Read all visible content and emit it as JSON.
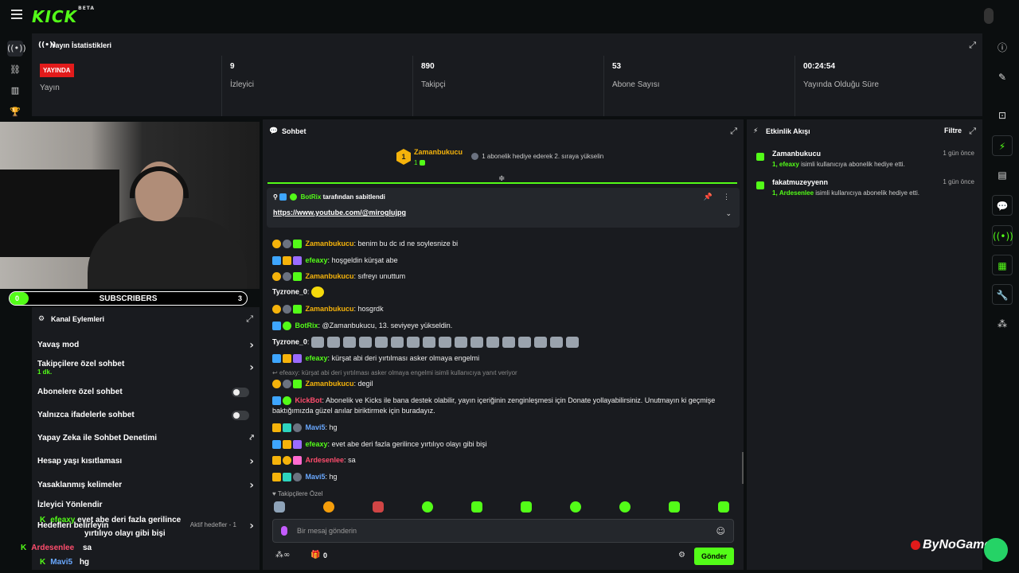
{
  "brand": {
    "logo": "KICK",
    "beta": "BETA"
  },
  "stats": {
    "title": "Yayın İstatistikleri",
    "live_badge": "YAYINDA",
    "items": [
      {
        "value": "",
        "label": "Yayın"
      },
      {
        "value": "9",
        "label": "İzleyici"
      },
      {
        "value": "890",
        "label": "Takipçi"
      },
      {
        "value": "53",
        "label": "Abone Sayısı"
      },
      {
        "value": "00:24:54",
        "label": "Yayında Olduğu Süre"
      }
    ]
  },
  "subs_goal": {
    "title": "SUBSCRIBERS",
    "current": "0",
    "target": "3"
  },
  "channel_actions": {
    "title": "Kanal Eylemleri",
    "rows": [
      {
        "label": "Yavaş mod"
      },
      {
        "label": "Takipçilere özel sohbet",
        "sub": "1 dk."
      },
      {
        "label": "Abonelere özel sohbet"
      },
      {
        "label": "Yalnızca ifadelerle sohbet"
      },
      {
        "label": "Yapay Zeka ile Sohbet Denetimi"
      },
      {
        "label": "Hesap yaşı kısıtlaması"
      },
      {
        "label": "Yasaklanmış kelimeler"
      },
      {
        "label": "İzleyici Yönlendir"
      },
      {
        "label": "Hedefleri belirleyin",
        "note": "Aktif hedefler - 1"
      }
    ]
  },
  "overlay_chat": [
    {
      "user": "efeaxy",
      "text": "evet abe deri fazla gerilince",
      "text2": "yırtılıyo olayı gibi bişi"
    },
    {
      "user": "Ardesenlee",
      "text": "sa"
    },
    {
      "user": "Mavi5",
      "text": "hg"
    }
  ],
  "chat": {
    "title": "Sohbet",
    "gift_leader": {
      "rank": "1",
      "name": "Zamanbukucu",
      "count": "1",
      "message": "1 abonelik hediye ederek 2. sıraya yükselin"
    },
    "pinned": {
      "by": "BotRix",
      "by_suffix": "tarafından sabitlendi",
      "link": "https://www.youtube.com/@miroglujpg"
    },
    "messages": [
      {
        "user": "Zamanbukucu",
        "sep": ": ",
        "text": "benim bu dc ıd ne soylesnize bi"
      },
      {
        "user": "efeaxy",
        "sep": ": ",
        "text": "hoşgeldin kürşat abe"
      },
      {
        "user": "Zamanbukucu",
        "sep": ": ",
        "text": "sıfreyı unuttum"
      },
      {
        "user": "Tyzrone_0",
        "sep": ": ",
        "text": ""
      },
      {
        "user": "Zamanbukucu",
        "sep": ": ",
        "text": "hosgrdk"
      },
      {
        "user": "BotRix",
        "sep": ": ",
        "text": "@Zamanbukucu, 13. seviyeye yükseldin."
      },
      {
        "user": "Tyzrone_0",
        "sep": ": ",
        "text": ""
      },
      {
        "user": "efeaxy",
        "sep": ": ",
        "text": "kürşat abi deri yırtılması asker olmaya engelmi"
      },
      {
        "user": "Zamanbukucu",
        "sep": ": ",
        "text": "degil"
      },
      {
        "user": "KickBot",
        "sep": ": ",
        "text": "Abonelik ve Kicks ile bana destek olabilir, yayın içeriğinin zenginleşmesi için Donate yollayabilirsiniz. Unutmayın ki geçmişe",
        "text2": "baktığımızda güzel anılar biriktirmek için buradayız."
      },
      {
        "user": "Mavi5",
        "sep": ": ",
        "text": "hg"
      },
      {
        "user": "efeaxy",
        "sep": ": ",
        "text": "evet abe deri fazla gerilince yırtılıyo olayı gibi bişi"
      },
      {
        "user": "Ardesenlee",
        "sep": ": ",
        "text": "sa"
      },
      {
        "user": "Mavi5",
        "sep": ": ",
        "text": "hg"
      }
    ],
    "reply_note": "efeaxy: kürşat abi deri yırtılması asker olmaya engelmi isimli kullanıcıya yanıt veriyor",
    "emote_label": "Takipçilere Özel",
    "input_placeholder": "Bir mesaj gönderin",
    "gift_count": "0",
    "send_label": "Gönder"
  },
  "activity": {
    "title": "Etkinlik Akışı",
    "filter": "Filtre",
    "items": [
      {
        "name": "Zamanbukucu",
        "when": "1 gün önce",
        "amount": "1,",
        "gifter": "efeaxy",
        "desc": "isimli kullanıcıya abonelik hediye etti."
      },
      {
        "name": "fakatmuzeyyenn",
        "when": "1 gün önce",
        "amount": "1,",
        "gifter": "Ardesenlee",
        "desc": "isimli kullanıcıya abonelik hediye etti."
      }
    ]
  },
  "watermark": "ByNoGame",
  "colors": {
    "accent": "#53fc18",
    "live": "#e21b1b",
    "gold": "#f5b30b",
    "panel": "#191b1f"
  }
}
